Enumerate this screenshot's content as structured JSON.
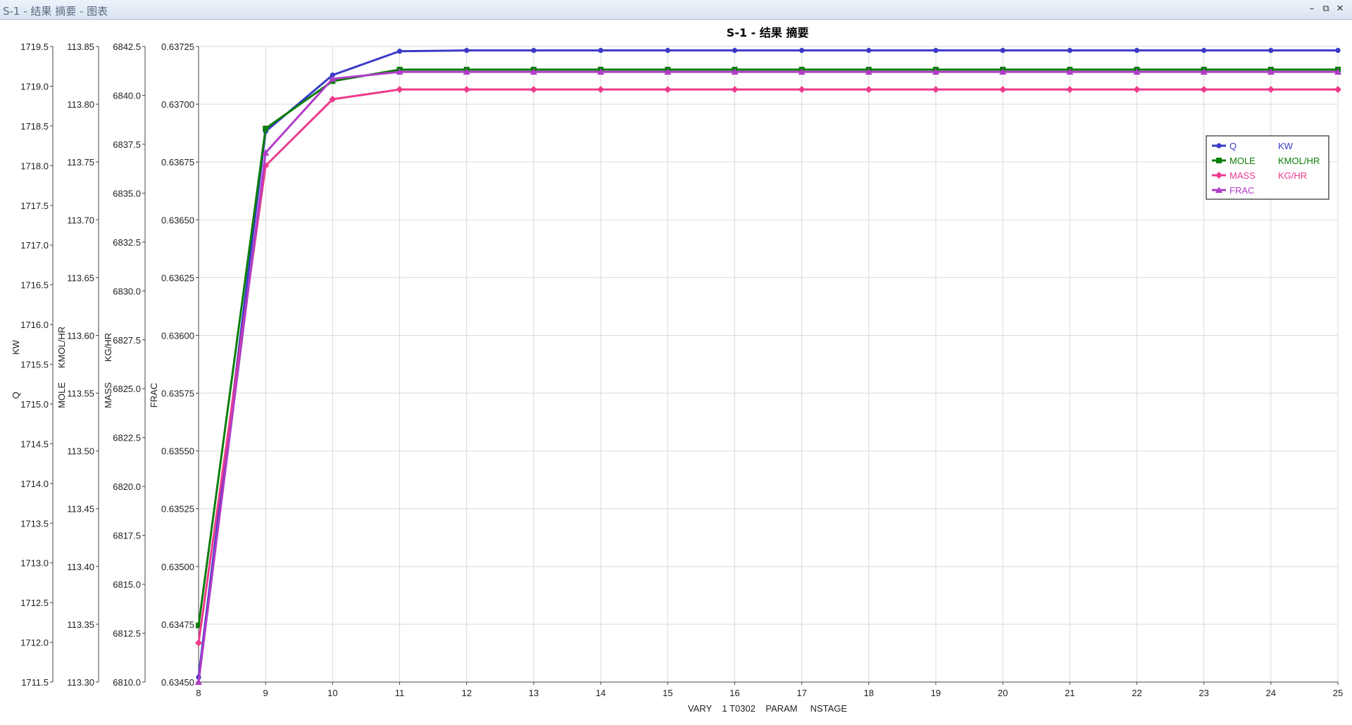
{
  "window": {
    "title": "S-1 - 结果 摘要 - 图表",
    "minimize_icon": "minimize-icon",
    "restore_icon": "restore-icon",
    "close_icon": "close-icon"
  },
  "chart_data": {
    "type": "line",
    "title": "S-1 - 结果 摘要",
    "xlabel": "VARY    1 T0302    PARAM     NSTAGE",
    "x": [
      8,
      9,
      10,
      11,
      12,
      13,
      14,
      15,
      16,
      17,
      18,
      19,
      20,
      21,
      22,
      23,
      24,
      25
    ],
    "xlim": [
      8,
      25
    ],
    "grid": true,
    "legend_position": "top-right",
    "axes": [
      {
        "id": "q",
        "label_name": "Q",
        "label_unit": "KW",
        "ylim": [
          1711.5,
          1719.5
        ],
        "ticks": [
          1711.5,
          1712.0,
          1712.5,
          1713.0,
          1713.5,
          1714.0,
          1714.5,
          1715.0,
          1715.5,
          1716.0,
          1716.5,
          1717.0,
          1717.5,
          1718.0,
          1718.5,
          1719.0,
          1719.5
        ],
        "decimals": 1
      },
      {
        "id": "mole",
        "label_name": "MOLE",
        "label_unit": "KMOL/HR",
        "ylim": [
          113.3,
          113.85
        ],
        "ticks": [
          113.3,
          113.35,
          113.4,
          113.45,
          113.5,
          113.55,
          113.6,
          113.65,
          113.7,
          113.75,
          113.8,
          113.85
        ],
        "decimals": 2
      },
      {
        "id": "mass",
        "label_name": "MASS",
        "label_unit": "KG/HR",
        "ylim": [
          6810.0,
          6842.5
        ],
        "ticks": [
          6810.0,
          6812.5,
          6815.0,
          6817.5,
          6820.0,
          6822.5,
          6825.0,
          6827.5,
          6830.0,
          6832.5,
          6835.0,
          6837.5,
          6840.0,
          6842.5
        ],
        "decimals": 1
      },
      {
        "id": "frac",
        "label_name": "FRAC",
        "label_unit": "",
        "ylim": [
          0.6345,
          0.63725
        ],
        "ticks": [
          0.6345,
          0.63475,
          0.635,
          0.63525,
          0.6355,
          0.63575,
          0.636,
          0.63625,
          0.6365,
          0.63675,
          0.637,
          0.63725
        ],
        "decimals": 5
      }
    ],
    "series": [
      {
        "name": "Q",
        "unit": "KW",
        "axis": "q",
        "color": "#3a3ac8",
        "marker": "circle",
        "values": [
          1711.56,
          1718.43,
          1719.14,
          1719.44,
          1719.45,
          1719.45,
          1719.45,
          1719.45,
          1719.45,
          1719.45,
          1719.45,
          1719.45,
          1719.45,
          1719.45,
          1719.45,
          1719.45,
          1719.45,
          1719.45
        ]
      },
      {
        "name": "MOLE",
        "unit": "KMOL/HR",
        "axis": "mole",
        "color": "#0a7d0a",
        "marker": "square",
        "values": [
          113.349,
          113.779,
          113.82,
          113.83,
          113.83,
          113.83,
          113.83,
          113.83,
          113.83,
          113.83,
          113.83,
          113.83,
          113.83,
          113.83,
          113.83,
          113.83,
          113.83,
          113.83
        ]
      },
      {
        "name": "MASS",
        "unit": "KG/HR",
        "axis": "mass",
        "color": "#ee3a8c",
        "marker": "diamond",
        "values": [
          6812.0,
          6836.4,
          6839.8,
          6840.3,
          6840.3,
          6840.3,
          6840.3,
          6840.3,
          6840.3,
          6840.3,
          6840.3,
          6840.3,
          6840.3,
          6840.3,
          6840.3,
          6840.3,
          6840.3,
          6840.3
        ]
      },
      {
        "name": "FRAC",
        "unit": "",
        "axis": "frac",
        "color": "#b03cc8",
        "marker": "triangle",
        "values": [
          0.6345,
          0.63679,
          0.63711,
          0.63714,
          0.63714,
          0.63714,
          0.63714,
          0.63714,
          0.63714,
          0.63714,
          0.63714,
          0.63714,
          0.63714,
          0.63714,
          0.63714,
          0.63714,
          0.63714,
          0.63714
        ]
      }
    ]
  }
}
